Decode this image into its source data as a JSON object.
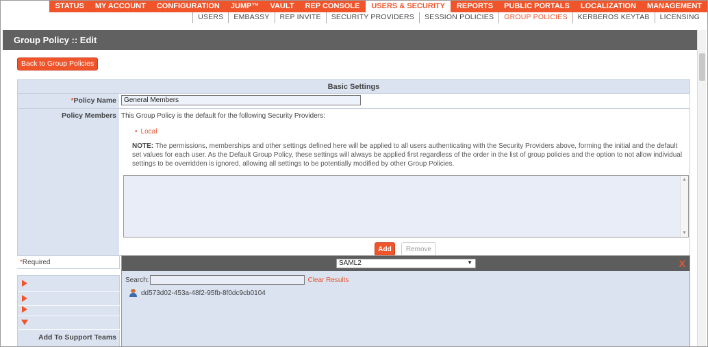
{
  "top_nav": [
    "STATUS",
    "MY ACCOUNT",
    "CONFIGURATION",
    "JUMP™",
    "VAULT",
    "REP CONSOLE",
    "USERS & SECURITY",
    "REPORTS",
    "PUBLIC PORTALS",
    "LOCALIZATION",
    "MANAGEMENT"
  ],
  "sub_nav": [
    "USERS",
    "EMBASSY",
    "REP INVITE",
    "SECURITY PROVIDERS",
    "SESSION POLICIES",
    "GROUP POLICIES",
    "KERBEROS KEYTAB",
    "LICENSING"
  ],
  "page_title": "Group Policy :: Edit",
  "back_button": "Back to Group Policies",
  "basic_settings": {
    "header": "Basic Settings",
    "policy_name_label": "Policy Name",
    "policy_name_value": "General Members",
    "policy_members_label": "Policy Members",
    "members_intro": "This Group Policy is the default for the following Security Providers:",
    "provider": "Local",
    "note_label": "NOTE:",
    "note_text": " The permissions, memberships and other settings defined here will be applied to all users authenticating with the Security Providers above, forming the initial and the default set values for each user. As the Default Group Policy, these settings will always be applied first regardless of the order in the list of group policies and the option to not allow individual settings to be overridden is ignored, allowing all settings to be potentially modified by other Group Policies.",
    "add_button": "Add",
    "remove_button": "Remove"
  },
  "required_note": "Required",
  "add_to_support_teams": "Add To Support Teams",
  "popup": {
    "provider_select": "SAML2",
    "close": "X",
    "search_label": "Search:",
    "search_value": "",
    "clear_results": "Clear Results",
    "result": "dd573d02-453a-48f2-95fb-8f0dc9cb0104"
  },
  "colors": {
    "accent": "#f0542a",
    "panel": "#dbe3f1",
    "titlebar": "#616161"
  },
  "icons": [
    "user-icon",
    "expand-arrow-icon",
    "collapse-arrow-icon",
    "dropdown-arrow-icon",
    "close-icon"
  ]
}
